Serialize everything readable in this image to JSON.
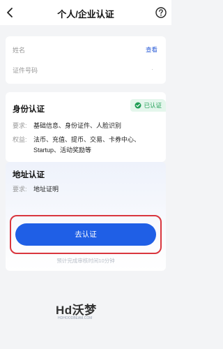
{
  "header": {
    "title": "个人/企业认证"
  },
  "info": {
    "name_label": "姓名",
    "view_link": "查看",
    "id_label": "证件号码",
    "id_value": "·"
  },
  "identity": {
    "title": "身份认证",
    "badge": "已认证",
    "requirement_label": "要求:",
    "requirement_value": "基础信息、身份证件、人脸识别",
    "rights_label": "权益:",
    "rights_value": "法币、充值、提币、交易、卡券中心、Startup、活动奖励等"
  },
  "address": {
    "title": "地址认证",
    "requirement_label": "要求:",
    "requirement_value": "地址证明",
    "button_label": "去认证",
    "hint": "预计完成审核时间10分钟"
  },
  "watermark": {
    "main": "Hd沃梦",
    "sub": "HDHOODBEAM.COM"
  },
  "colors": {
    "accent": "#1f5fe6",
    "success": "#1f9d55",
    "highlight": "#d9363e"
  }
}
